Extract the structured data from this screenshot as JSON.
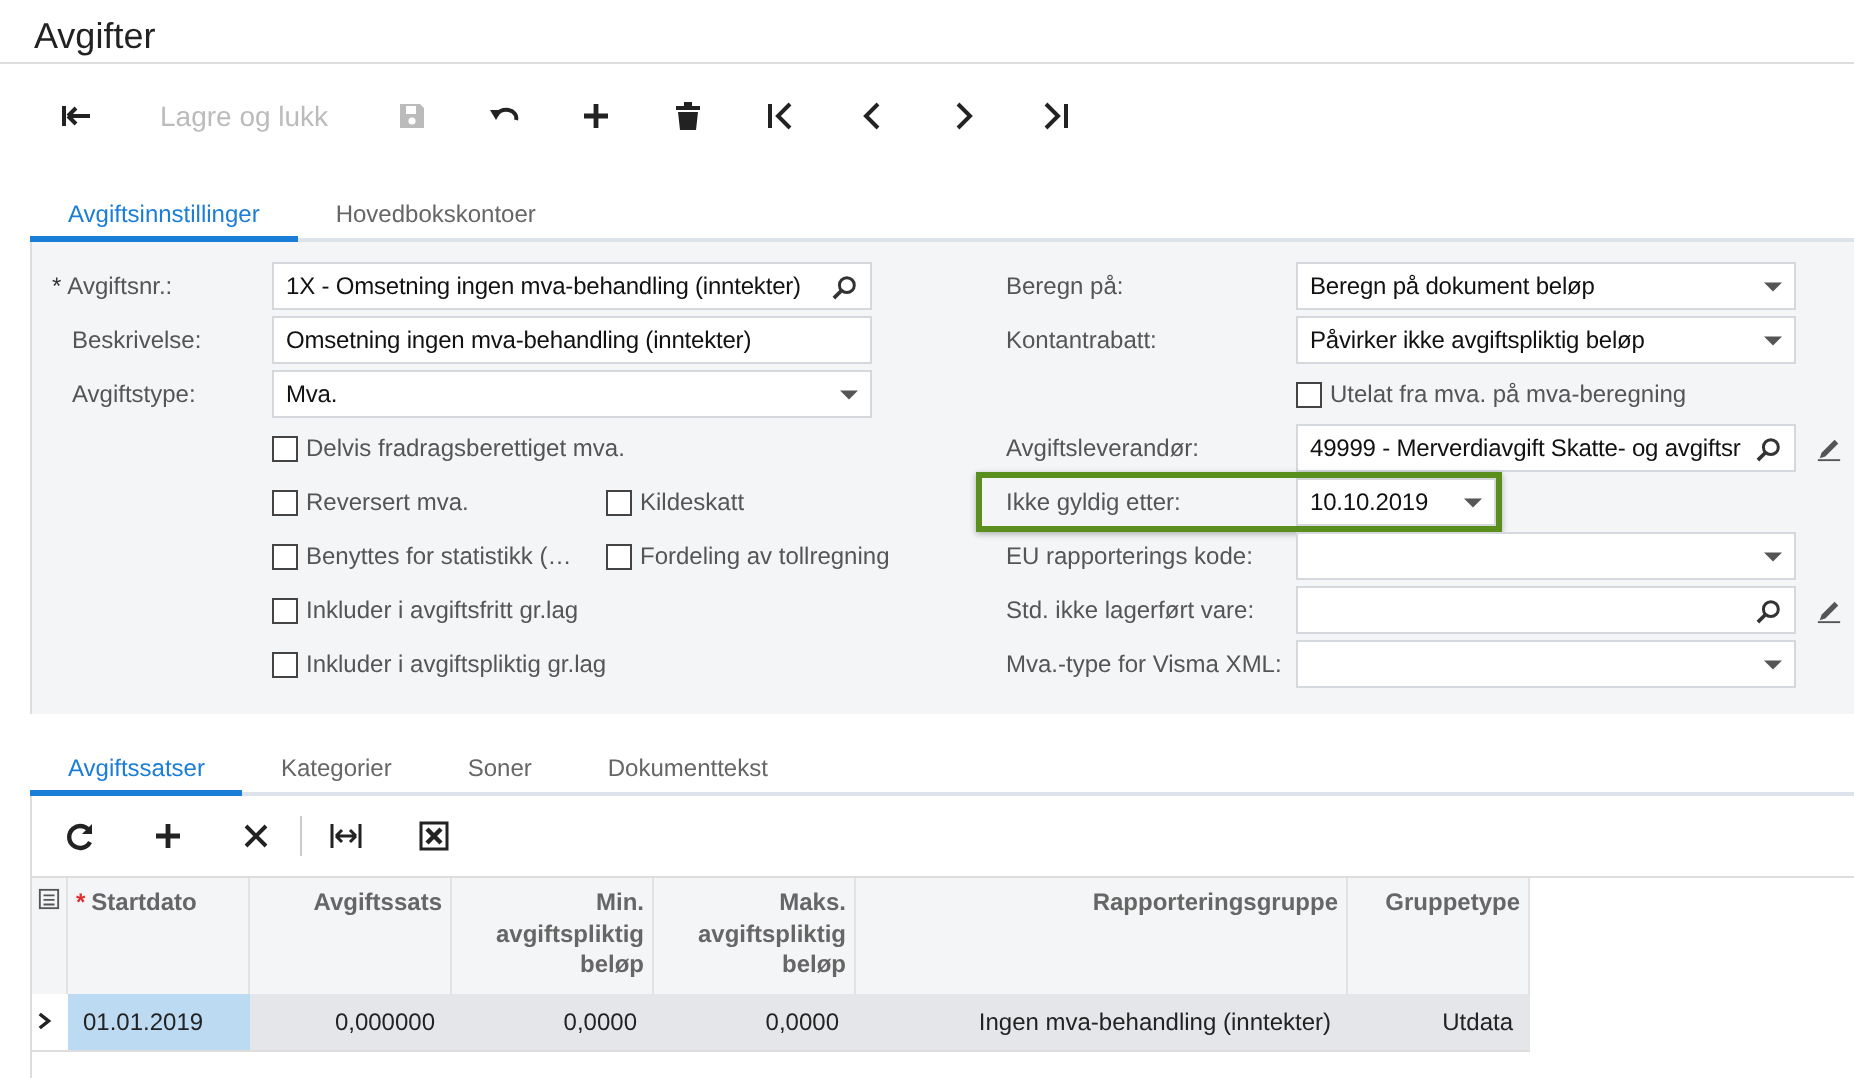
{
  "title": "Avgifter",
  "toolbar": [
    {
      "kind": "back",
      "disabled": false
    },
    {
      "kind": "text",
      "label": "Lagre og lukk",
      "disabled": true
    },
    {
      "kind": "save",
      "disabled": true
    },
    {
      "kind": "undo",
      "disabled": false
    },
    {
      "kind": "add",
      "disabled": false
    },
    {
      "kind": "delete",
      "disabled": false
    },
    {
      "kind": "first",
      "disabled": false
    },
    {
      "kind": "prev",
      "disabled": false
    },
    {
      "kind": "next",
      "disabled": false
    },
    {
      "kind": "last",
      "disabled": false
    }
  ],
  "form_tabs": [
    {
      "label": "Avgiftsinnstillinger",
      "selected": true
    },
    {
      "label": "Hovedbokskontoer",
      "selected": false
    }
  ],
  "left_fields": [
    {
      "label": "Avgiftsnr.:",
      "required_mark": "*",
      "kind": "lookup",
      "value": "1X - Omsetning ingen mva-behandling (inntekter)"
    },
    {
      "label": "Beskrivelse:",
      "kind": "text",
      "value": "Omsetning ingen mva-behandling (inntekter)"
    },
    {
      "label": "Avgiftstype:",
      "kind": "select",
      "value": "Mva."
    }
  ],
  "left_checkboxes": [
    [
      {
        "label": "Delvis fradragsberettiget mva.",
        "checked": false
      }
    ],
    [
      {
        "label": "Reversert mva.",
        "checked": false
      },
      {
        "label": "Kildeskatt",
        "checked": false
      }
    ],
    [
      {
        "label": "Benyttes for statistikk (…",
        "checked": false
      },
      {
        "label": "Fordeling av tollregning",
        "checked": false
      }
    ],
    [
      {
        "label": "Inkluder i avgiftsfritt gr.lag",
        "checked": false
      }
    ],
    [
      {
        "label": "Inkluder i avgiftspliktig gr.lag",
        "checked": false
      }
    ]
  ],
  "right_fields": [
    {
      "kind": "select",
      "label": "Beregn på:",
      "value": "Beregn på dokument beløp",
      "editable": false,
      "highlighted": false
    },
    {
      "kind": "select",
      "label": "Kontantrabatt:",
      "value": "Påvirker ikke avgiftspliktig beløp",
      "editable": false,
      "highlighted": false
    },
    {
      "kind": "checkbox",
      "label": "Utelat fra mva. på mva-beregning",
      "checked": false
    },
    {
      "kind": "lookup",
      "label": "Avgiftsleverandør:",
      "value": "49999 - Merverdiavgift Skatte- og avgiftsr",
      "editable": true,
      "highlighted": false
    },
    {
      "kind": "date",
      "label": "Ikke gyldig etter:",
      "value": "10.10.2019",
      "editable": false,
      "highlighted": true
    },
    {
      "kind": "select",
      "label": "EU rapporterings kode:",
      "editable": false,
      "highlighted": false
    },
    {
      "kind": "lookup",
      "label": "Std. ikke lagerført vare:",
      "editable": true,
      "highlighted": false
    },
    {
      "kind": "select",
      "label": "Mva.-type for Visma XML:",
      "editable": false,
      "highlighted": false
    }
  ],
  "detail_tabs": [
    {
      "label": "Avgiftssatser",
      "selected": true
    },
    {
      "label": "Kategorier",
      "selected": false
    },
    {
      "label": "Soner",
      "selected": false
    },
    {
      "label": "Dokumenttekst",
      "selected": false
    }
  ],
  "grid_toolbar": [
    {
      "kind": "refresh"
    },
    {
      "kind": "add"
    },
    {
      "kind": "delete"
    },
    {
      "kind": "fit"
    },
    {
      "kind": "excel"
    }
  ],
  "table": {
    "columns": [
      {
        "label": "Startdato",
        "required_mark": "*"
      },
      {
        "label": "Avgiftssats"
      },
      {
        "label": "Min.\navgiftspliktig\nbeløp"
      },
      {
        "label": "Maks.\navgiftspliktig\nbeløp"
      },
      {
        "label": "Rapporteringsgruppe"
      },
      {
        "label": "Gruppetype"
      }
    ],
    "rows": [
      {
        "current": true,
        "cells": [
          {
            "text": "01.01.2019",
            "active": true
          },
          {
            "text": "0,000000",
            "active": false
          },
          {
            "text": "0,0000",
            "active": false
          },
          {
            "text": "0,0000",
            "active": false
          },
          {
            "text": "Ingen mva-behandling (inntekter)",
            "active": false
          },
          {
            "text": "Utdata",
            "active": false
          }
        ]
      }
    ]
  }
}
